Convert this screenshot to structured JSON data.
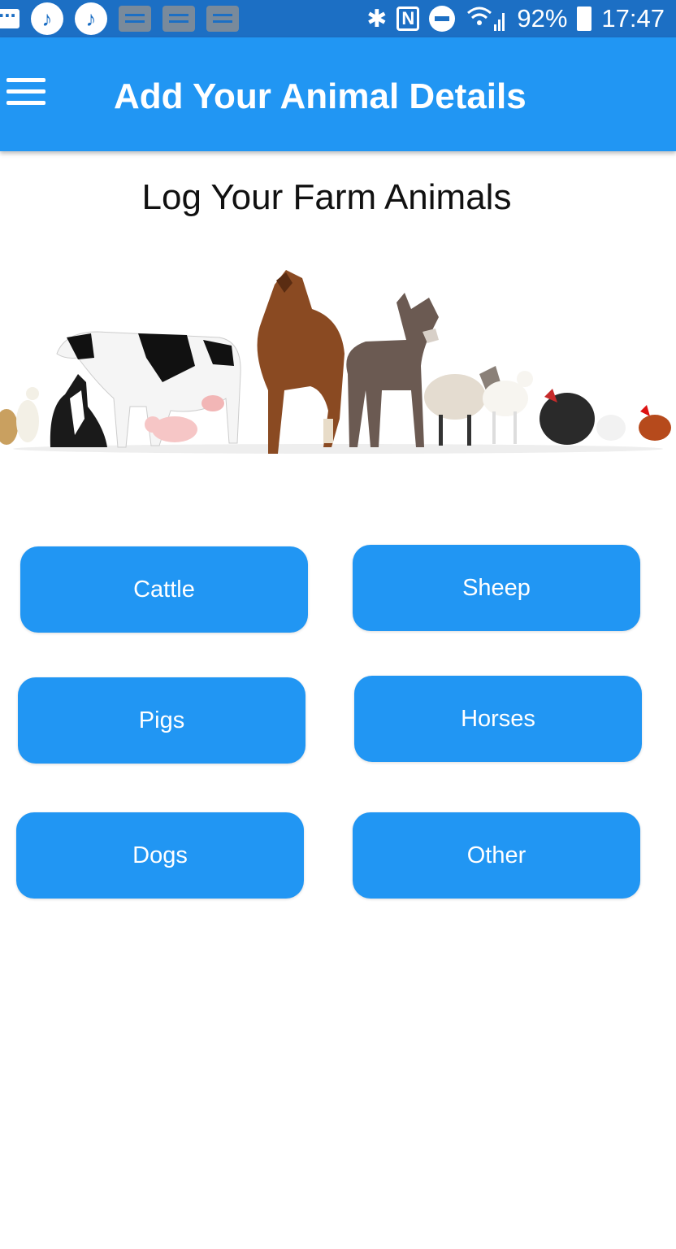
{
  "status_bar": {
    "battery": "92%",
    "time": "17:47"
  },
  "app_bar": {
    "title": "Add Your Animal Details"
  },
  "main": {
    "heading": "Log Your Farm Animals",
    "buttons": [
      {
        "label": "Cattle"
      },
      {
        "label": "Sheep"
      },
      {
        "label": "Pigs"
      },
      {
        "label": "Horses"
      },
      {
        "label": "Dogs"
      },
      {
        "label": "Other"
      }
    ]
  },
  "colors": {
    "status_bar": "#1c6fc4",
    "primary": "#2196f3",
    "text": "#111111"
  }
}
